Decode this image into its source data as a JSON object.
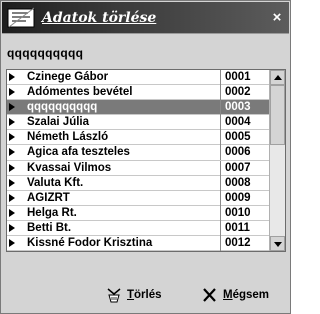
{
  "window": {
    "title": "Adatok törlése",
    "close_label": "×"
  },
  "search": {
    "value": "qqqqqqqqqq"
  },
  "grid": {
    "rows": [
      {
        "name": "Czinege Gábor",
        "code": "0001"
      },
      {
        "name": "Adómentes bevétel",
        "code": "0002"
      },
      {
        "name": "qqqqqqqqqq",
        "code": "0003",
        "selected": true
      },
      {
        "name": "Szalai Júlia",
        "code": "0004"
      },
      {
        "name": "Németh László",
        "code": "0005"
      },
      {
        "name": "Agica afa teszteles",
        "code": "0006"
      },
      {
        "name": "Kvassai Vilmos",
        "code": "0007"
      },
      {
        "name": "Valuta Kft.",
        "code": "0008"
      },
      {
        "name": "AGIZRT",
        "code": "0009"
      },
      {
        "name": "Helga Rt.",
        "code": "0010"
      },
      {
        "name": "Betti Bt.",
        "code": "0011"
      },
      {
        "name": "Kissné Fodor Krisztina",
        "code": "0012"
      }
    ],
    "scroll_position": 0
  },
  "buttons": {
    "delete_label": "Törlés",
    "cancel_label": "Mégsem"
  },
  "colors": {
    "selected_row": "#7a7a7a",
    "titlebar": "#2a2a2a"
  }
}
